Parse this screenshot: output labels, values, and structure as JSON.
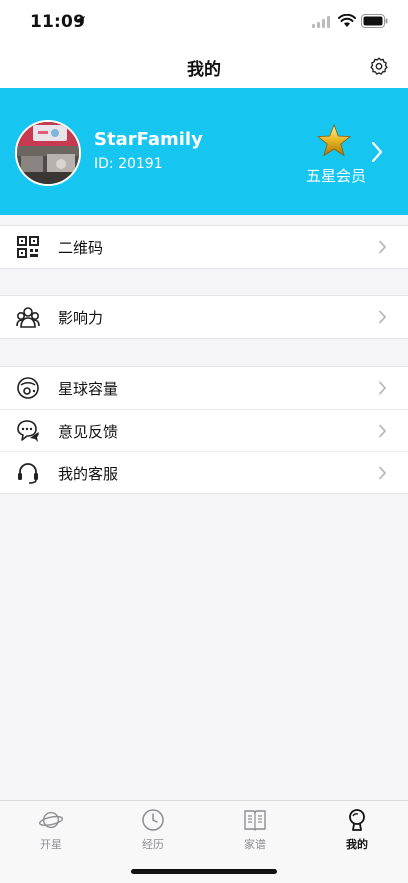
{
  "status_bar": {
    "time": "11:09"
  },
  "nav": {
    "title": "我的"
  },
  "profile": {
    "username": "StarFamily",
    "user_id": "ID: 20191",
    "member_level": "五星会员"
  },
  "menu": {
    "group1": [
      {
        "label": "二维码",
        "icon": "qr-code-icon"
      }
    ],
    "group2": [
      {
        "label": "影响力",
        "icon": "influence-group-icon"
      }
    ],
    "group3": [
      {
        "label": "星球容量",
        "icon": "storage-planet-icon"
      },
      {
        "label": "意见反馈",
        "icon": "feedback-chat-icon"
      },
      {
        "label": "我的客服",
        "icon": "headset-icon"
      }
    ]
  },
  "tabs": [
    {
      "label": "开星",
      "icon": "planet-icon",
      "active": false
    },
    {
      "label": "经历",
      "icon": "clock-icon",
      "active": false
    },
    {
      "label": "家谱",
      "icon": "book-icon",
      "active": false
    },
    {
      "label": "我的",
      "icon": "user-icon",
      "active": true
    }
  ],
  "colors": {
    "banner": "#16c5f0",
    "background": "#f5f5f7",
    "tab_active": "#111111",
    "tab_inactive": "#8e8e93"
  }
}
